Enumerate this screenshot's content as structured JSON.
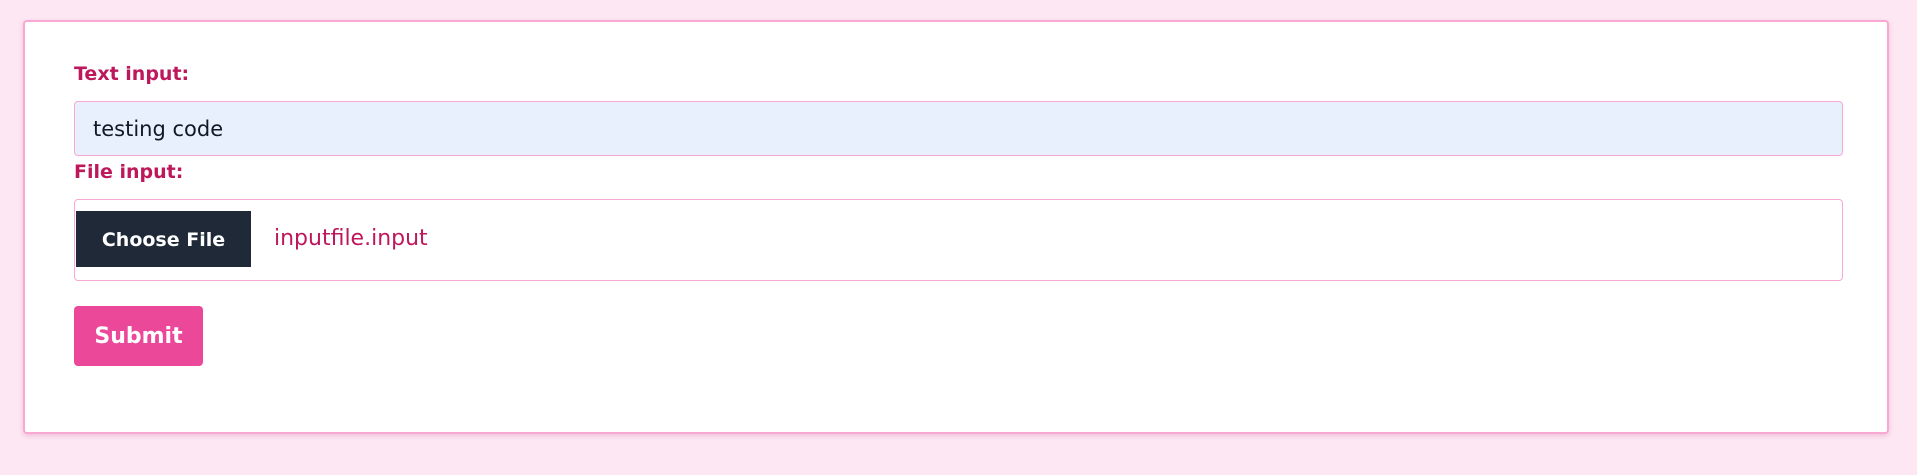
{
  "form": {
    "text_label": "Text input:",
    "text_value": "testing code",
    "file_label": "File input:",
    "file_button_label": "Choose File",
    "file_name": "inputfile.input",
    "submit_label": "Submit"
  },
  "colors": {
    "background": "#fce7f3",
    "card_border": "#f9a8d4",
    "label": "#be185d",
    "text_input_bg": "#e8f0fe",
    "file_button_bg": "#1f2937",
    "submit_bg": "#ec4899"
  }
}
